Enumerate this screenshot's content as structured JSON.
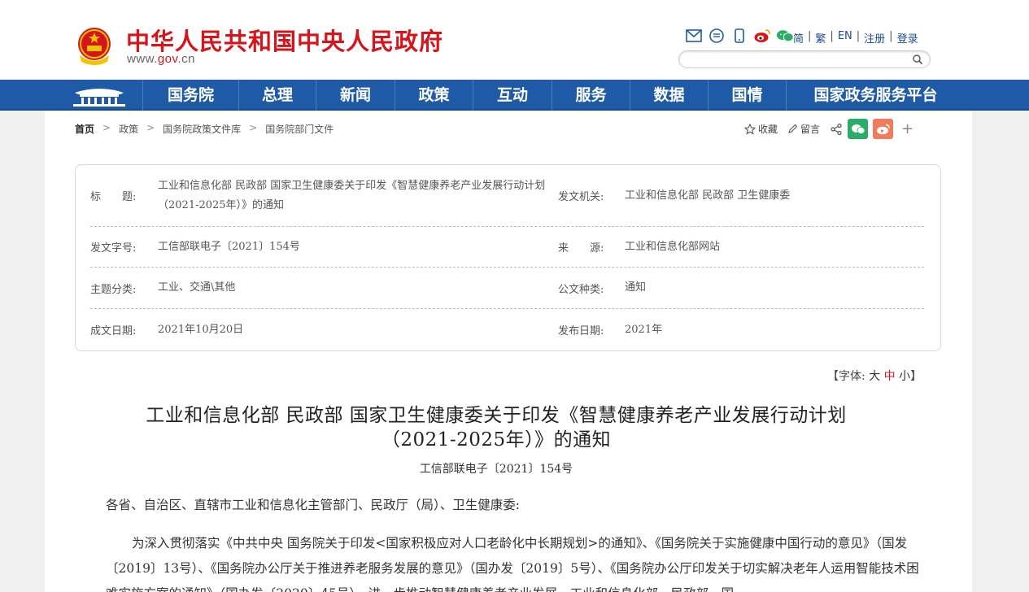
{
  "header": {
    "site_title": "中华人民共和国中央人民政府",
    "url_prefix": "www.",
    "url_domain": "gov",
    "url_suffix": ".cn",
    "top_links": [
      "简",
      "繁",
      "EN",
      "注册",
      "登录"
    ],
    "search_placeholder": ""
  },
  "nav": {
    "items": [
      "国务院",
      "总理",
      "新闻",
      "政策",
      "互动",
      "服务",
      "数据",
      "国情",
      "国家政务服务平台"
    ]
  },
  "breadcrumb": [
    "首页",
    "政策",
    "国务院政策文件库",
    "国务院部门文件"
  ],
  "share": {
    "collect": "收藏",
    "comment": "留言"
  },
  "info": {
    "title_label": "标　　题:",
    "title_value": "工业和信息化部 民政部 国家卫生健康委关于印发《智慧健康养老产业发展行动计划（2021-2025年）》的通知",
    "issuer_label": "发文机关:",
    "issuer_value": "工业和信息化部 民政部 卫生健康委",
    "docno_label": "发文字号:",
    "docno_value": "工信部联电子〔2021〕154号",
    "source_label": "来　　源:",
    "source_value": "工业和信息化部网站",
    "topic_label": "主题分类:",
    "topic_value": "工业、交通\\其他",
    "type_label": "公文种类:",
    "type_value": "通知",
    "written_label": "成文日期:",
    "written_value": "2021年10月20日",
    "publish_label": "发布日期:",
    "publish_value": "2021年"
  },
  "fontsize": {
    "prefix": "【字体:",
    "big": "大",
    "mid": "中",
    "small": "小",
    "suffix": "】"
  },
  "article": {
    "title_line1": "工业和信息化部 民政部 国家卫生健康委关于印发《智慧健康养老产业发展行动计划",
    "title_line2": "（2021-2025年）》的通知",
    "doc_no": "工信部联电子〔2021〕154号",
    "salutation": "各省、自治区、直辖市工业和信息化主管部门、民政厅（局）、卫生健康委:",
    "para1": "为深入贯彻落实《中共中央 国务院关于印发<国家积极应对人口老龄化中长期规划>的通知》、《国务院关于实施健康中国行动的意见》（国发〔2019〕13号）、《国务院办公厅关于推进养老服务发展的意见》（国办发〔2019〕5号）、《国务院办公厅印发关于切实解决老年人运用智能技术困难实施方案的通知》（国办发〔2020〕45号），进一步推动智慧健康养老产业发展，工业和信息化部、民政部、国"
  }
}
